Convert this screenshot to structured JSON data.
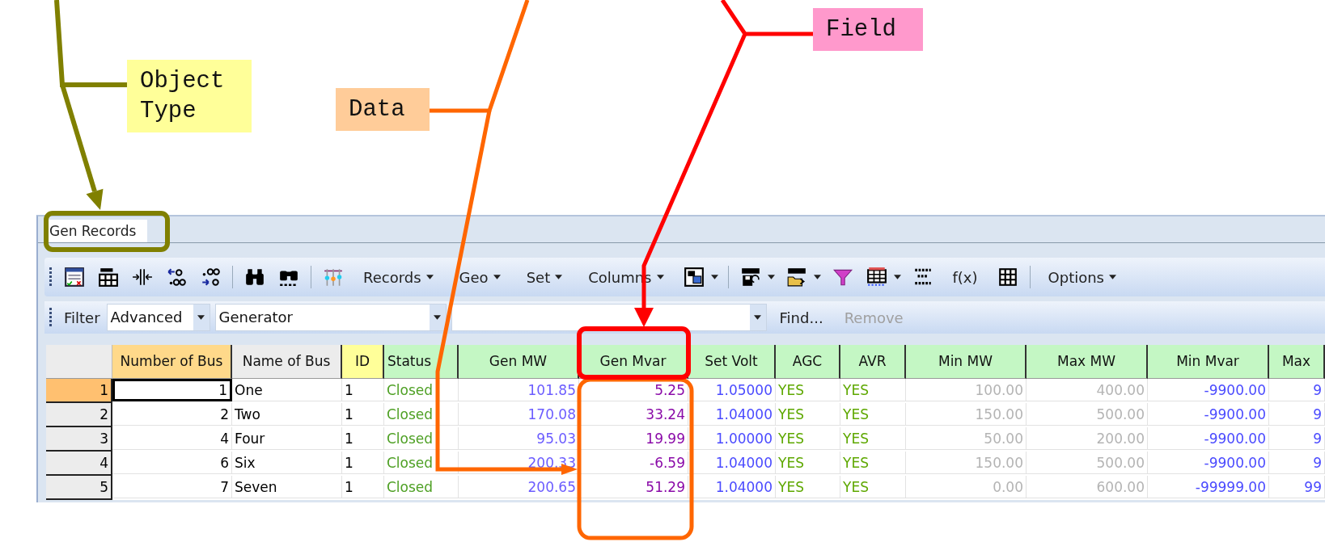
{
  "annotations": [
    {
      "text": "Object Type",
      "color": "#ffff99"
    },
    {
      "text": "Data",
      "color": "#ffcc99"
    },
    {
      "text": "Field",
      "color": "#ff99cc"
    }
  ],
  "tabs": [
    {
      "label": "Gen Records",
      "selected": true
    }
  ],
  "toolbar": {
    "menus": [
      "Records",
      "Geo",
      "Set",
      "Columns"
    ],
    "function_button": "f(x)",
    "options": "Options"
  },
  "filter": {
    "label": "Filter",
    "mode": "Advanced",
    "object": "Generator",
    "find": "Find...",
    "remove": "Remove",
    "remove_disabled": true
  },
  "table": {
    "columns": [
      {
        "label": "Number of Bus",
        "color": "#ffd98a",
        "kind": "key"
      },
      {
        "label": "Name of Bus",
        "color": "#ececec",
        "kind": "text"
      },
      {
        "label": "ID",
        "color": "#ffff99",
        "kind": "text"
      },
      {
        "label": "Status",
        "color": "#c4f7c4",
        "kind": "status"
      },
      {
        "label": "Gen MW",
        "color": "#c4f7c4",
        "kind": "output"
      },
      {
        "label": "Gen Mvar",
        "color": "#c4f7c4",
        "kind": "reactive"
      },
      {
        "label": "Set Volt",
        "color": "#c4f7c4",
        "kind": "input"
      },
      {
        "label": "AGC",
        "color": "#c4f7c4",
        "kind": "flag"
      },
      {
        "label": "AVR",
        "color": "#c4f7c4",
        "kind": "flag"
      },
      {
        "label": "Min MW",
        "color": "#c4f7c4",
        "kind": "limit"
      },
      {
        "label": "Max MW",
        "color": "#c4f7c4",
        "kind": "limit"
      },
      {
        "label": "Min Mvar",
        "color": "#c4f7c4",
        "kind": "input"
      },
      {
        "label": "Max",
        "color": "#c4f7c4",
        "kind": "input"
      }
    ],
    "rows": [
      {
        "number": "1",
        "selected": true,
        "cells": [
          "1",
          "One",
          "1",
          "Closed",
          "101.85",
          "5.25",
          "1.05000",
          "YES",
          "YES",
          "100.00",
          "400.00",
          "-9900.00",
          "9"
        ]
      },
      {
        "number": "2",
        "selected": false,
        "cells": [
          "2",
          "Two",
          "1",
          "Closed",
          "170.08",
          "33.24",
          "1.04000",
          "YES",
          "YES",
          "150.00",
          "500.00",
          "-9900.00",
          "9"
        ]
      },
      {
        "number": "3",
        "selected": false,
        "cells": [
          "4",
          "Four",
          "1",
          "Closed",
          "95.03",
          "19.99",
          "1.00000",
          "YES",
          "YES",
          "50.00",
          "200.00",
          "-9900.00",
          "9"
        ]
      },
      {
        "number": "4",
        "selected": false,
        "cells": [
          "6",
          "Six",
          "1",
          "Closed",
          "200.33",
          "-6.59",
          "1.04000",
          "YES",
          "YES",
          "150.00",
          "500.00",
          "-9900.00",
          "9"
        ]
      },
      {
        "number": "5",
        "selected": false,
        "cells": [
          "7",
          "Seven",
          "1",
          "Closed",
          "200.65",
          "51.29",
          "1.04000",
          "YES",
          "YES",
          "0.00",
          "600.00",
          "-99999.00",
          "99"
        ]
      }
    ]
  }
}
